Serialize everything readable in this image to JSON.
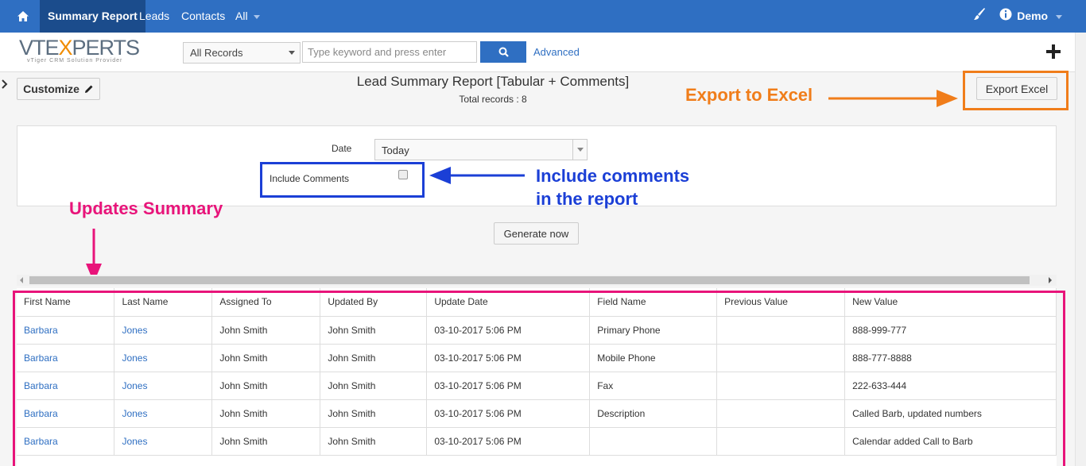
{
  "nav": {
    "items": [
      "Summary Report",
      "Leads",
      "Contacts",
      "All"
    ],
    "user": "Demo"
  },
  "header": {
    "logo_main_a": "VTE",
    "logo_main_x": "X",
    "logo_main_b": "PERTS",
    "logo_sub": "vTiger CRM Solution Provider",
    "records_select": "All Records",
    "search_placeholder": "Type keyword and press enter",
    "advanced_label": "Advanced"
  },
  "report": {
    "customize_label": "Customize",
    "title": "Lead Summary Report [Tabular + Comments]",
    "total_records": "Total records : 8",
    "export_label": "Export Excel",
    "date_label": "Date",
    "date_value": "Today",
    "include_comments_label": "Include Comments",
    "generate_label": "Generate now"
  },
  "annotations": {
    "export": "Export to Excel",
    "comments_line1": "Include comments",
    "comments_line2": "in the report",
    "updates": "Updates Summary"
  },
  "colors": {
    "nav_bg": "#2f6fc2",
    "export_annotation": "#f07d1a",
    "comments_annotation": "#1b3fd6",
    "updates_annotation": "#e8147a"
  },
  "table": {
    "columns": [
      "First Name",
      "Last Name",
      "Assigned To",
      "Updated By",
      "Update Date",
      "Field Name",
      "Previous Value",
      "New Value"
    ],
    "rows": [
      [
        "Barbara",
        "Jones",
        "John Smith",
        "John Smith",
        "03-10-2017 5:06 PM",
        "Primary Phone",
        "",
        "888-999-777"
      ],
      [
        "Barbara",
        "Jones",
        "John Smith",
        "John Smith",
        "03-10-2017 5:06 PM",
        "Mobile Phone",
        "",
        "888-777-8888"
      ],
      [
        "Barbara",
        "Jones",
        "John Smith",
        "John Smith",
        "03-10-2017 5:06 PM",
        "Fax",
        "",
        "222-633-444"
      ],
      [
        "Barbara",
        "Jones",
        "John Smith",
        "John Smith",
        "03-10-2017 5:06 PM",
        "Description",
        "",
        "Called Barb, updated numbers"
      ],
      [
        "Barbara",
        "Jones",
        "John Smith",
        "John Smith",
        "03-10-2017 5:06 PM",
        "",
        "",
        "Calendar added  Call to Barb"
      ]
    ]
  }
}
